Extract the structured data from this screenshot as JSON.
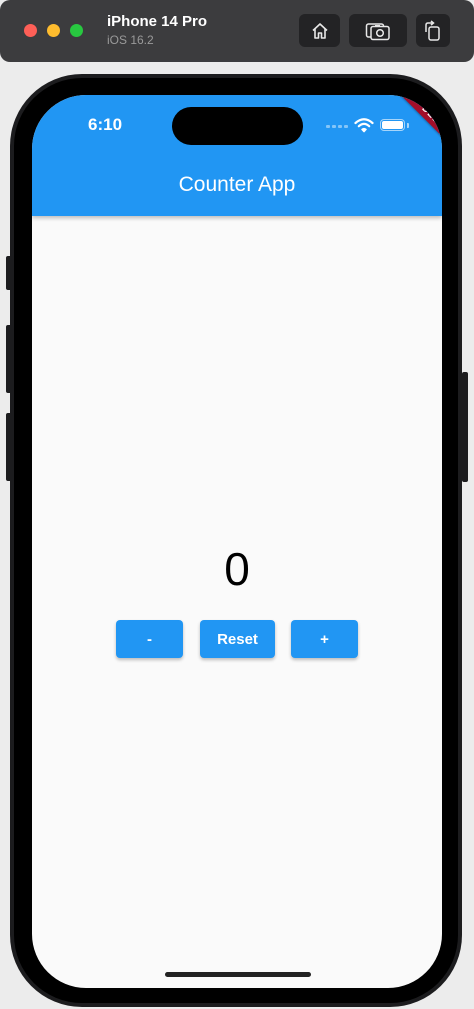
{
  "simulator": {
    "device_name": "iPhone 14 Pro",
    "os_version": "iOS 16.2",
    "toolbar_icons": [
      "home-icon",
      "screenshot-icon",
      "rotate-icon"
    ]
  },
  "status_bar": {
    "time": "6:10"
  },
  "debug_banner": "DEBUG",
  "app_bar": {
    "title": "Counter App",
    "color": "#2196f3"
  },
  "counter": {
    "value": "0"
  },
  "buttons": {
    "decrement_label": "-",
    "reset_label": "Reset",
    "increment_label": "+"
  }
}
